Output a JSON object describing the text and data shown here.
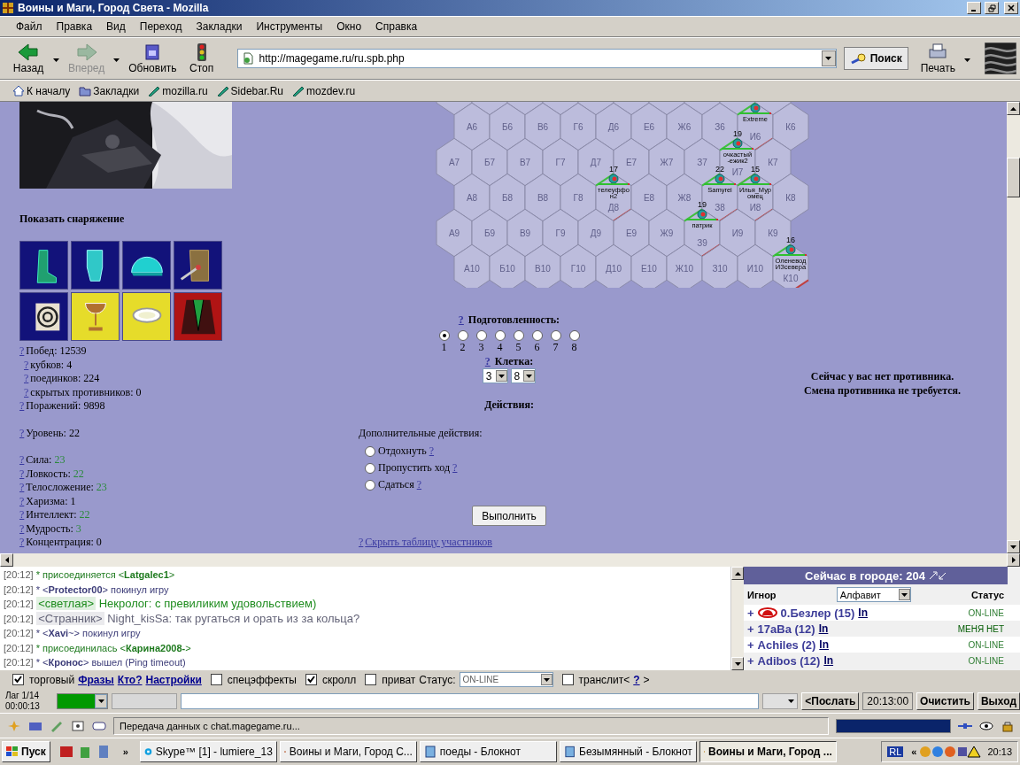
{
  "window": {
    "title": "Воины и Маги, Город Света - Mozilla"
  },
  "menu": [
    "Файл",
    "Правка",
    "Вид",
    "Переход",
    "Закладки",
    "Инструменты",
    "Окно",
    "Справка"
  ],
  "nav_buttons": [
    {
      "kind": "back",
      "label": "Назад",
      "disabled": false,
      "dropdown": true
    },
    {
      "kind": "forward",
      "label": "Вперед",
      "disabled": true,
      "dropdown": true
    },
    {
      "kind": "reload",
      "label": "Обновить",
      "disabled": false,
      "dropdown": false
    },
    {
      "kind": "stop",
      "label": "Стоп",
      "disabled": false,
      "dropdown": false
    }
  ],
  "address": {
    "value": "http://magegame.ru/ru.spb.php"
  },
  "search_button": "Поиск",
  "print_button": "Печать",
  "bookmarks": [
    {
      "kind": "home",
      "label": "К началу"
    },
    {
      "kind": "folder",
      "label": "Закладки"
    },
    {
      "kind": "link",
      "label": "mozilla.ru"
    },
    {
      "kind": "link",
      "label": "Sidebar.Ru"
    },
    {
      "kind": "link",
      "label": "mozdev.ru"
    }
  ],
  "profile": {
    "equipment_title": "Показать снаряжение",
    "equipment": [
      {
        "kind": "boot",
        "color": "#12127a"
      },
      {
        "kind": "gauntlet",
        "color": "#12127a"
      },
      {
        "kind": "helmet",
        "color": "#12127a"
      },
      {
        "kind": "armor",
        "color": "#12127a"
      },
      {
        "kind": "target",
        "color": "#12127a"
      },
      {
        "kind": "goblet",
        "color": "#e6dc2a"
      },
      {
        "kind": "ring",
        "color": "#e6dc2a"
      },
      {
        "kind": "cloak",
        "color": "#b01414"
      }
    ],
    "stat_groups": [
      {
        "items": [
          {
            "help": "?",
            "label": "Побед:",
            "value": "12539",
            "kind": "main",
            "boosted": false
          },
          {
            "help": "?",
            "label": "кубков:",
            "value": "4",
            "kind": "sub",
            "boosted": false
          },
          {
            "help": "?",
            "label": "поединков:",
            "value": "224",
            "kind": "sub",
            "boosted": false
          },
          {
            "help": "?",
            "label": "скрытых противников:",
            "value": "0",
            "kind": "sub",
            "boosted": false
          },
          {
            "help": "?",
            "label": "Поражений:",
            "value": "9898",
            "kind": "main",
            "boosted": false
          }
        ]
      },
      {
        "items": [
          {
            "help": "?",
            "label": "Уровень:",
            "value": "22",
            "kind": "main",
            "boosted": false
          }
        ]
      },
      {
        "items": [
          {
            "help": "?",
            "label": "Сила:",
            "value": "23",
            "kind": "main",
            "boosted": true
          },
          {
            "help": "?",
            "label": "Ловкость:",
            "value": "22",
            "kind": "main",
            "boosted": true
          },
          {
            "help": "?",
            "label": "Телосложение:",
            "value": "23",
            "kind": "main",
            "boosted": true
          },
          {
            "help": "?",
            "label": "Харизма:",
            "value": "1",
            "kind": "main",
            "boosted": false
          },
          {
            "help": "?",
            "label": "Интеллект:",
            "value": "22",
            "kind": "main",
            "boosted": true
          },
          {
            "help": "?",
            "label": "Мудрость:",
            "value": "3",
            "kind": "main",
            "boosted": true
          },
          {
            "help": "?",
            "label": "Концентрация:",
            "value": "0",
            "kind": "main",
            "boosted": false
          }
        ]
      }
    ]
  },
  "battle": {
    "map": {
      "rows": [
        {
          "cells": [
            {
              "label": "А6"
            },
            {
              "label": "Б6"
            },
            {
              "label": "В6"
            },
            {
              "label": "Г6"
            },
            {
              "label": "Д6"
            },
            {
              "label": "Е6"
            },
            {
              "label": "Ж6"
            },
            {
              "label": "З6"
            },
            {
              "label": "И6",
              "unit": {
                "name_lines": [
                  "Extreme"
                ]
              }
            },
            {
              "label": "К6"
            }
          ]
        },
        {
          "cells": [
            {
              "label": "А7"
            },
            {
              "label": "Б7"
            },
            {
              "label": "В7"
            },
            {
              "label": "Г7"
            },
            {
              "label": "Д7"
            },
            {
              "label": "Е7"
            },
            {
              "label": "Ж7"
            },
            {
              "label": "З7"
            },
            {
              "label": "И7",
              "unit": {
                "level": "19",
                "name_lines": [
                  "очкастый",
                  "-ежик2"
                ]
              }
            },
            {
              "label": "К7"
            }
          ]
        },
        {
          "cells": [
            {
              "label": "А8"
            },
            {
              "label": "Б8"
            },
            {
              "label": "В8"
            },
            {
              "label": "Г8"
            },
            {
              "label": "Д8",
              "unit": {
                "level": "17",
                "name_lines": [
                  "телеуффо",
                  "н2"
                ]
              }
            },
            {
              "label": "Е8"
            },
            {
              "label": "Ж8"
            },
            {
              "label": "З8",
              "unit": {
                "level": "22",
                "name_lines": [
                  "Samyrei"
                ]
              }
            },
            {
              "label": "И8",
              "unit": {
                "level": "15",
                "name_lines": [
                  "Илья_Мур",
                  "омец"
                ]
              }
            },
            {
              "label": "К8"
            }
          ]
        },
        {
          "cells": [
            {
              "label": "А9"
            },
            {
              "label": "Б9"
            },
            {
              "label": "В9"
            },
            {
              "label": "Г9"
            },
            {
              "label": "Д9"
            },
            {
              "label": "Е9"
            },
            {
              "label": "Ж9"
            },
            {
              "label": "З9",
              "unit": {
                "level": "19",
                "name_lines": [
                  "патрик"
                ]
              }
            },
            {
              "label": "И9"
            },
            {
              "label": "К9"
            }
          ]
        },
        {
          "cells": [
            {
              "label": "А10"
            },
            {
              "label": "Б10"
            },
            {
              "label": "В10"
            },
            {
              "label": "Г10"
            },
            {
              "label": "Д10"
            },
            {
              "label": "Е10"
            },
            {
              "label": "Ж10"
            },
            {
              "label": "З10"
            },
            {
              "label": "И10"
            },
            {
              "label": "К10",
              "unit": {
                "level": "16",
                "name_lines": [
                  "Оленевод",
                  "ИЗсевера"
                ]
              }
            }
          ]
        }
      ]
    },
    "readiness": {
      "help": "?",
      "title": "Подготовленность:",
      "options": [
        {
          "label": "1",
          "selected": true
        },
        {
          "label": "2",
          "selected": false
        },
        {
          "label": "3",
          "selected": false
        },
        {
          "label": "4",
          "selected": false
        },
        {
          "label": "5",
          "selected": false
        },
        {
          "label": "6",
          "selected": false
        },
        {
          "label": "7",
          "selected": false
        },
        {
          "label": "8",
          "selected": false
        }
      ]
    },
    "cell": {
      "help": "?",
      "title": "Клетка:",
      "selects": [
        "3",
        "8"
      ]
    },
    "actions_title": "Действия:",
    "extra": {
      "title": "Дополнительные действия:",
      "options": [
        {
          "label": "Отдохнуть",
          "help": "?",
          "selected": false
        },
        {
          "label": "Пропустить ход",
          "help": "?",
          "selected": false
        },
        {
          "label": "Сдаться",
          "help": "?",
          "selected": false
        }
      ]
    },
    "submit": "Выполнить",
    "hide_link": {
      "help": "?",
      "label": "Скрыть таблицу участников"
    }
  },
  "opponent": [
    "Сейчас у вас нет противника.",
    "Смена противника не требуется."
  ],
  "chat": [
    {
      "time": "[20:12]",
      "kind": "event",
      "text": "* присоединяется <**Latgalec1**>",
      "color": "#1e7a1e"
    },
    {
      "time": "[20:12]",
      "kind": "event",
      "text": "* <**Protector00**> покинул игру",
      "color": "#3c3c78"
    },
    {
      "time": "[20:12]",
      "kind": "message",
      "nick": "<светлая>",
      "text": "Некролог: с превиликим удовольствием)",
      "color": "#1e8c1e"
    },
    {
      "time": "[20:12]",
      "kind": "message",
      "nick": "<Странник>",
      "text": "Night_kisSa: так ругаться и орать из за кольца?",
      "color": "#646478"
    },
    {
      "time": "[20:12]",
      "kind": "event",
      "text": "* <**Xavi**~> покинул игру",
      "color": "#3c3c78"
    },
    {
      "time": "[20:12]",
      "kind": "event",
      "text": "* присоединилась <**Карина2008-**>",
      "color": "#1e7a1e"
    },
    {
      "time": "[20:12]",
      "kind": "event",
      "text": "* <**Кронос**> вышел (Ping timeout)",
      "color": "#3c3c78"
    }
  ],
  "city": {
    "title": "Сейчас в городе: 204",
    "ignore": "Игнор",
    "sort": "Алфавит",
    "status": "Статус",
    "players": [
      {
        "plus": "+",
        "clan_icon": true,
        "name": "0.Безлер (15)",
        "link": "In",
        "status": "ON-LINE",
        "kind": "online"
      },
      {
        "plus": "+",
        "clan_icon": false,
        "name": "17aBa (12)",
        "link": "In",
        "status": "МЕНЯ НЕТ",
        "kind": "away"
      },
      {
        "plus": "+",
        "clan_icon": false,
        "name": "Achiles (2)",
        "link": "In",
        "status": "ON-LINE",
        "kind": "online"
      },
      {
        "plus": "+",
        "clan_icon": false,
        "name": "Adibos (12)",
        "link": "In",
        "status": "ON-LINE",
        "kind": "online"
      }
    ]
  },
  "options": [
    {
      "kind": "check",
      "label": "торговый",
      "checked": true
    },
    {
      "kind": "link",
      "label": "Фразы"
    },
    {
      "kind": "link",
      "label": "Кто?"
    },
    {
      "kind": "link",
      "label": "Настройки"
    },
    {
      "kind": "check",
      "label": "спецэффекты",
      "checked": false
    },
    {
      "kind": "check",
      "label": "скролл",
      "checked": true
    },
    {
      "kind": "check",
      "label": "приват",
      "checked": false
    },
    {
      "kind": "text",
      "label": "Статус:"
    },
    {
      "kind": "select",
      "label": "ON-LINE"
    },
    {
      "kind": "check",
      "label": "транслит<",
      "checked": false
    },
    {
      "kind": "link",
      "label": "?"
    },
    {
      "kind": "text",
      "label": ">"
    }
  ],
  "input_bar": {
    "lag": [
      "Лаг 1/14",
      "00:00:13"
    ],
    "clock": "20:13:00",
    "buttons": [
      "<Послать",
      "Очистить",
      "Выход"
    ]
  },
  "status_bar": {
    "text": "Передача данных с chat.magegame.ru...",
    "level": 1
  },
  "taskbar": {
    "start": "Пуск",
    "overflow": "»",
    "tasks": [
      {
        "kind": "skype",
        "label": "Skype™ [1] - lumiere_13",
        "selected": false
      },
      {
        "kind": "browser",
        "label": "Воины и Маги, Город С...",
        "selected": false
      },
      {
        "kind": "notepad",
        "label": "поеды - Блокнот",
        "selected": false
      },
      {
        "kind": "notepad",
        "label": "Безымянный - Блокнот",
        "selected": false
      },
      {
        "kind": "game",
        "label": "Воины и Маги, Город ...",
        "selected": true
      }
    ],
    "lang": "RL",
    "expand": "«",
    "clock": "20:13"
  }
}
